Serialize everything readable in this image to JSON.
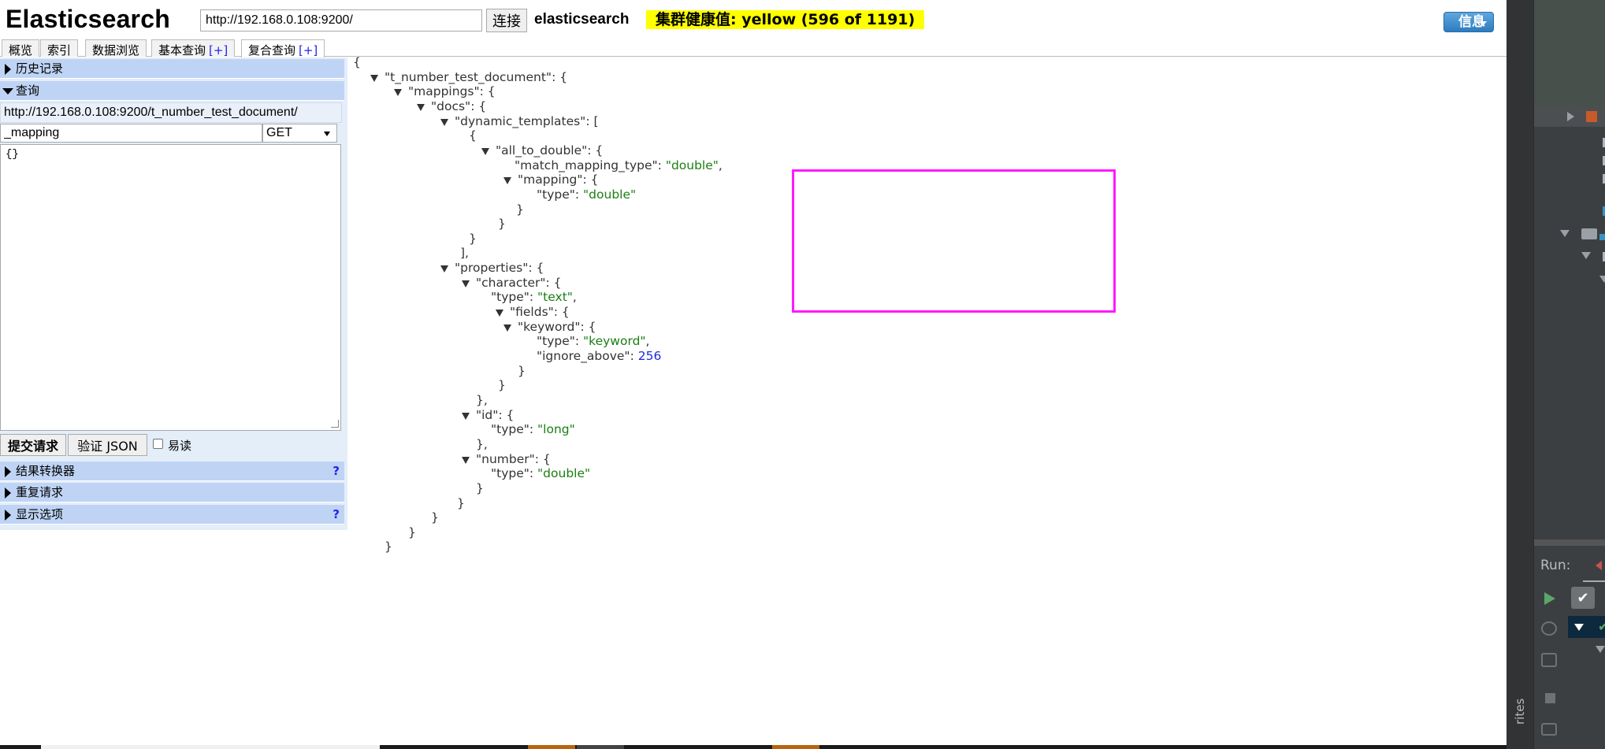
{
  "header": {
    "logo": "Elasticsearch",
    "url_value": "http://192.168.0.108:9200/",
    "connect_label": "连接",
    "cluster_name": "elasticsearch",
    "health": "集群健康值: yellow (596 of 1191)",
    "info_label": "信息",
    "health_color": "#ffff00"
  },
  "tabs": [
    {
      "label": "概览",
      "plus": ""
    },
    {
      "label": "索引",
      "plus": ""
    },
    {
      "label": "数据浏览",
      "plus": ""
    },
    {
      "label": "基本查询",
      "plus": "[+]"
    },
    {
      "label": "复合查询",
      "plus": "[+]"
    }
  ],
  "left": {
    "history_label": "历史记录",
    "query_label": "查询",
    "query_url": "http://192.168.0.108:9200/t_number_test_document/",
    "query_path": "_mapping",
    "method": "GET",
    "body": "{}",
    "submit_label": "提交请求",
    "validate_label": "验证 JSON",
    "pretty_label": "易读",
    "transformer_label": "结果转换器",
    "repeat_label": "重复请求",
    "display_label": "显示选项",
    "help": "?"
  },
  "json_lines": [
    {
      "parts": [
        [
          "p",
          "{"
        ]
      ]
    },
    {
      "parts": [
        [
          "k",
          "\"t_number_test_document\""
        ],
        [
          "p",
          ": {"
        ]
      ]
    },
    {
      "parts": [
        [
          "k",
          "\"mappings\""
        ],
        [
          "p",
          ": {"
        ]
      ]
    },
    {
      "parts": [
        [
          "k",
          "\"docs\""
        ],
        [
          "p",
          ": {"
        ]
      ]
    },
    {
      "parts": [
        [
          "k",
          "\"dynamic_templates\""
        ],
        [
          "p",
          ": ["
        ]
      ]
    },
    {
      "parts": [
        [
          "p",
          "{"
        ]
      ]
    },
    {
      "parts": [
        [
          "k",
          "\"all_to_double\""
        ],
        [
          "p",
          ": {"
        ]
      ]
    },
    {
      "parts": [
        [
          "k",
          "\"match_mapping_type\""
        ],
        [
          "p",
          ": "
        ],
        [
          "s",
          "\"double\""
        ],
        [
          "p",
          ","
        ]
      ]
    },
    {
      "parts": [
        [
          "k",
          "\"mapping\""
        ],
        [
          "p",
          ": {"
        ]
      ]
    },
    {
      "parts": [
        [
          "k",
          "\"type\""
        ],
        [
          "p",
          ": "
        ],
        [
          "s",
          "\"double\""
        ]
      ]
    },
    {
      "parts": [
        [
          "p",
          "}"
        ]
      ]
    },
    {
      "parts": [
        [
          "p",
          "}"
        ]
      ]
    },
    {
      "parts": [
        [
          "p",
          "}"
        ]
      ]
    },
    {
      "parts": [
        [
          "p",
          "],"
        ]
      ]
    },
    {
      "parts": [
        [
          "k",
          "\"properties\""
        ],
        [
          "p",
          ": {"
        ]
      ]
    },
    {
      "parts": [
        [
          "k",
          "\"character\""
        ],
        [
          "p",
          ": {"
        ]
      ]
    },
    {
      "parts": [
        [
          "k",
          "\"type\""
        ],
        [
          "p",
          ": "
        ],
        [
          "s",
          "\"text\""
        ],
        [
          "p",
          ","
        ]
      ]
    },
    {
      "parts": [
        [
          "k",
          "\"fields\""
        ],
        [
          "p",
          ": {"
        ]
      ]
    },
    {
      "parts": [
        [
          "k",
          "\"keyword\""
        ],
        [
          "p",
          ": {"
        ]
      ]
    },
    {
      "parts": [
        [
          "k",
          "\"type\""
        ],
        [
          "p",
          ": "
        ],
        [
          "s",
          "\"keyword\""
        ],
        [
          "p",
          ","
        ]
      ]
    },
    {
      "parts": [
        [
          "k",
          "\"ignore_above\""
        ],
        [
          "p",
          ": "
        ],
        [
          "n",
          "256"
        ]
      ]
    },
    {
      "parts": [
        [
          "p",
          "}"
        ]
      ]
    },
    {
      "parts": [
        [
          "p",
          "}"
        ]
      ]
    },
    {
      "parts": [
        [
          "p",
          "},"
        ]
      ]
    },
    {
      "parts": [
        [
          "k",
          "\"id\""
        ],
        [
          "p",
          ": {"
        ]
      ]
    },
    {
      "parts": [
        [
          "k",
          "\"type\""
        ],
        [
          "p",
          ": "
        ],
        [
          "s",
          "\"long\""
        ]
      ]
    },
    {
      "parts": [
        [
          "p",
          "},"
        ]
      ]
    },
    {
      "parts": [
        [
          "k",
          "\"number\""
        ],
        [
          "p",
          ": {"
        ]
      ]
    },
    {
      "parts": [
        [
          "k",
          "\"type\""
        ],
        [
          "p",
          ": "
        ],
        [
          "s",
          "\"double\""
        ]
      ]
    },
    {
      "parts": [
        [
          "p",
          "}"
        ]
      ]
    },
    {
      "parts": [
        [
          "p",
          "}"
        ]
      ]
    },
    {
      "parts": [
        [
          "p",
          "}"
        ]
      ]
    },
    {
      "parts": [
        [
          "p",
          "}"
        ]
      ]
    },
    {
      "parts": [
        [
          "p",
          "}"
        ]
      ]
    }
  ],
  "ide": {
    "run_label": "Run:",
    "favorites_label": "rites",
    "check_glyph": "✔"
  }
}
